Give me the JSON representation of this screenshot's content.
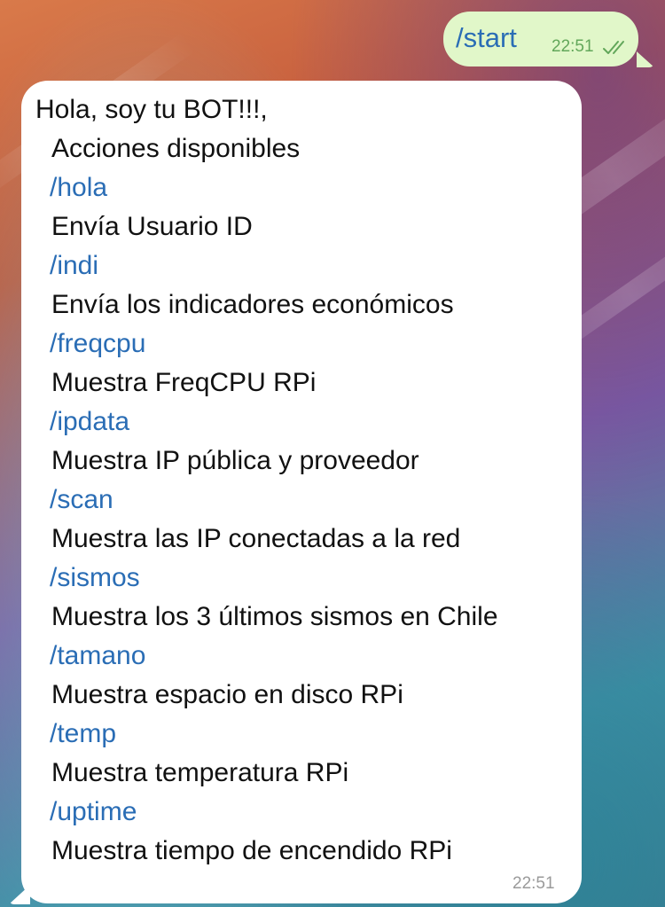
{
  "outgoing": {
    "text": "/start",
    "time": "22:51",
    "status_icon": "double-check-icon"
  },
  "incoming": {
    "greeting": "Hola, soy tu BOT!!!,",
    "intro": "Acciones disponibles",
    "commands": [
      {
        "command": "/hola",
        "description": "Envía Usuario ID"
      },
      {
        "command": "/indi",
        "description": "Envía los indicadores económicos"
      },
      {
        "command": "/freqcpu",
        "description": "Muestra FreqCPU RPi"
      },
      {
        "command": "/ipdata",
        "description": "Muestra IP pública y proveedor"
      },
      {
        "command": "/scan",
        "description": "Muestra las IP conectadas a la red"
      },
      {
        "command": "/sismos",
        "description": "Muestra los 3 últimos sismos en Chile"
      },
      {
        "command": "/tamano",
        "description": "Muestra espacio en disco RPi"
      },
      {
        "command": "/temp",
        "description": "Muestra temperatura RPi"
      },
      {
        "command": "/uptime",
        "description": "Muestra tiempo de encendido RPi"
      }
    ],
    "time": "22:51"
  },
  "colors": {
    "outgoing_bubble": "#e1f7c9",
    "incoming_bubble": "#ffffff",
    "link": "#2a6db5",
    "outgoing_meta": "#62a75a",
    "incoming_meta": "#9a9a9a"
  }
}
